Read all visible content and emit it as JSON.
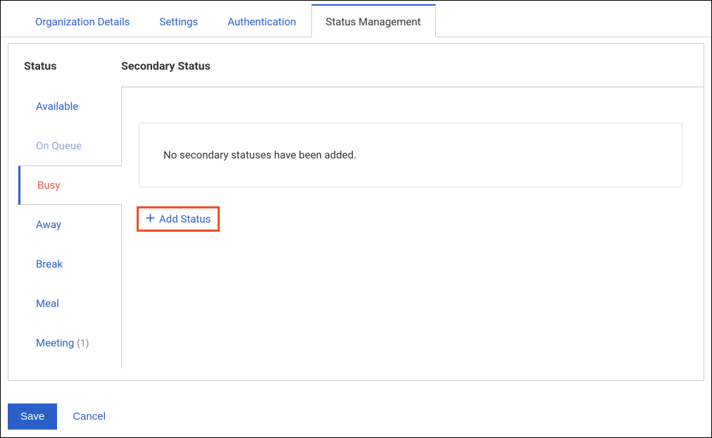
{
  "tabs": {
    "org_details": "Organization Details",
    "settings": "Settings",
    "authentication": "Authentication",
    "status_management": "Status Management"
  },
  "columns": {
    "status": "Status",
    "secondary": "Secondary Status"
  },
  "statuses": {
    "available": "Available",
    "on_queue": "On Queue",
    "busy": "Busy",
    "away": "Away",
    "break": "Break",
    "meal": "Meal",
    "meeting": "Meeting",
    "meeting_count": "(1)"
  },
  "panel": {
    "empty_message": "No secondary statuses have been added.",
    "add_button": "Add Status"
  },
  "footer": {
    "save": "Save",
    "cancel": "Cancel"
  }
}
